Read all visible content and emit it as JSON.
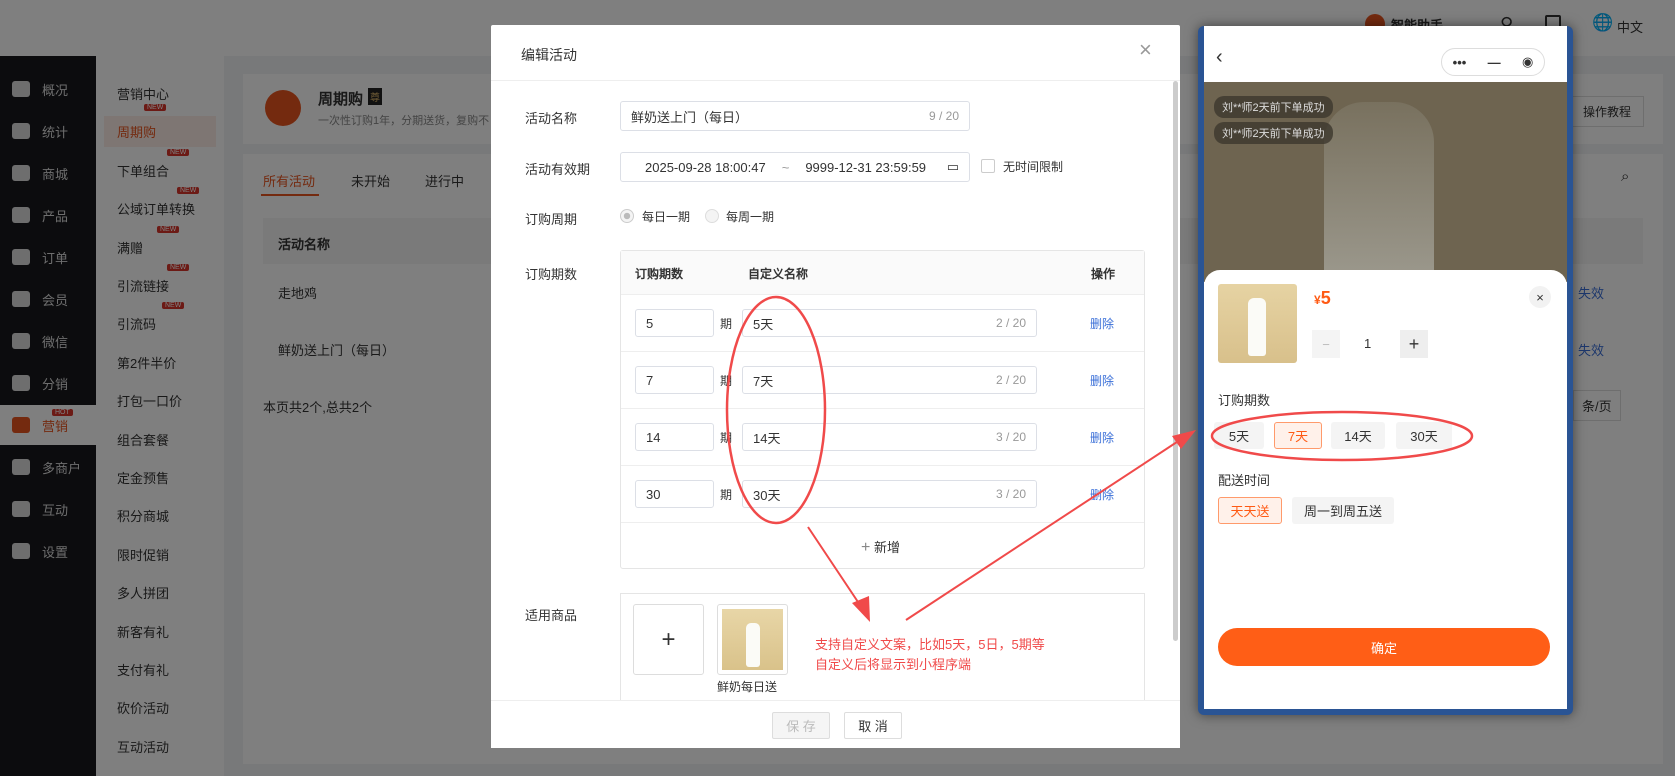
{
  "header": {
    "assistant": "智能助手",
    "language": "中文"
  },
  "sidebar": {
    "items": [
      {
        "label": "概况"
      },
      {
        "label": "统计"
      },
      {
        "label": "商城"
      },
      {
        "label": "产品"
      },
      {
        "label": "订单"
      },
      {
        "label": "会员"
      },
      {
        "label": "微信"
      },
      {
        "label": "分销"
      },
      {
        "label": "营销",
        "badge": "HOT"
      },
      {
        "label": "多商户"
      },
      {
        "label": "互动"
      },
      {
        "label": "设置"
      }
    ]
  },
  "submenu": {
    "items": [
      {
        "label": "营销中心"
      },
      {
        "label": "周期购",
        "badge": "NEW"
      },
      {
        "label": "下单组合",
        "badge": "NEW"
      },
      {
        "label": "公域订单转换",
        "badge": "NEW"
      },
      {
        "label": "满赠",
        "badge": "NEW"
      },
      {
        "label": "引流链接",
        "badge": "NEW"
      },
      {
        "label": "引流码",
        "badge": "NEW"
      },
      {
        "label": "第2件半价"
      },
      {
        "label": "打包一口价"
      },
      {
        "label": "组合套餐"
      },
      {
        "label": "定金预售"
      },
      {
        "label": "积分商城"
      },
      {
        "label": "限时促销"
      },
      {
        "label": "多人拼团"
      },
      {
        "label": "新客有礼"
      },
      {
        "label": "支付有礼"
      },
      {
        "label": "砍价活动"
      },
      {
        "label": "互动活动"
      }
    ]
  },
  "page": {
    "title": "周期购",
    "title_badge": "尊",
    "subtitle": "一次性订购1年，分期送货，复购不",
    "tutorial": "操作教程",
    "tabs": [
      "所有活动",
      "未开始",
      "进行中"
    ],
    "col_name": "活动名称",
    "rows": [
      {
        "name": "走地鸡",
        "action": "失效"
      },
      {
        "name": "鲜奶送上门（每日）",
        "action": "失效"
      }
    ],
    "summary": "本页共2个,总共2个",
    "page_size": "条/页"
  },
  "modal": {
    "title": "编辑活动",
    "name_label": "活动名称",
    "name_value": "鲜奶送上门（每日）",
    "name_count": "9 / 20",
    "period_label": "活动有效期",
    "start": "2025-09-28 18:00:47",
    "sep": "~",
    "end": "9999-12-31 23:59:59",
    "no_limit": "无时间限制",
    "cycle_label": "订购周期",
    "cycle_options": [
      "每日一期",
      "每周一期"
    ],
    "count_label": "订购期数",
    "table_headers": [
      "订购期数",
      "自定义名称",
      "操作"
    ],
    "unit": "期",
    "rows": [
      {
        "num": "5",
        "name": "5天",
        "count": "2 / 20"
      },
      {
        "num": "7",
        "name": "7天",
        "count": "2 / 20"
      },
      {
        "num": "14",
        "name": "14天",
        "count": "3 / 20"
      },
      {
        "num": "30",
        "name": "30天",
        "count": "3 / 20"
      }
    ],
    "delete": "删除",
    "add": "新增",
    "goods_label": "适用商品",
    "goods_name": "鲜奶每日送",
    "save": "保 存",
    "cancel": "取 消"
  },
  "annotation": {
    "line1": "支持自定义文案，比如5天，5日，5期等",
    "line2": "自定义后将显示到小程序端"
  },
  "phone": {
    "toasts": [
      "刘**师2天前下单成功",
      "刘**师2天前下单成功"
    ],
    "currency": "¥",
    "price": "5",
    "qty": "1",
    "count_title": "订购期数",
    "chips": [
      "5天",
      "7天",
      "14天",
      "30天"
    ],
    "delivery_title": "配送时间",
    "delivery": [
      "天天送",
      "周一到周五送"
    ],
    "confirm": "确定"
  },
  "colors": {
    "accent": "#ff5a14",
    "annotation": "#f04a4a"
  }
}
